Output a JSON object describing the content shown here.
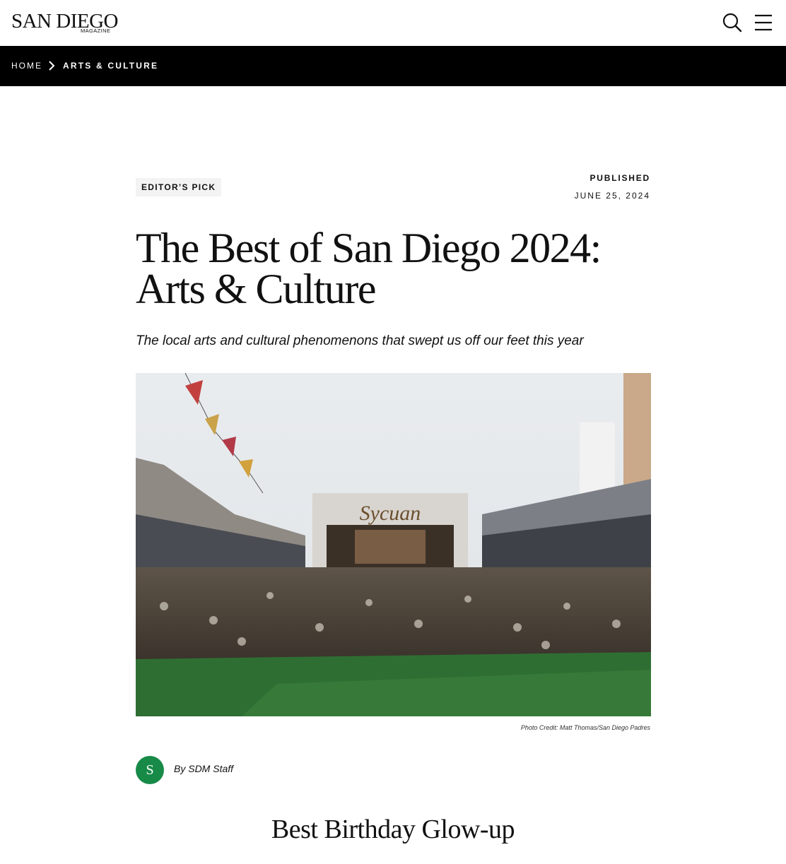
{
  "header": {
    "logo_main": "SAN DIEGO",
    "logo_sub": "MAGAZINE",
    "icons": {
      "search": "search-icon",
      "menu": "hamburger-menu-icon"
    }
  },
  "breadcrumb": {
    "home": "HOME",
    "current": "ARTS & CULTURE",
    "separator_icon": "chevron-right-icon"
  },
  "article": {
    "badge": "EDITOR’S PICK",
    "published_label": "PUBLISHED",
    "published_date": "JUNE 25, 2024",
    "title": "The Best of San Diego 2024: Arts & Culture",
    "dek": "The local arts and cultural phenomenons that swept us off our feet this year",
    "hero_sign": "Sycuan",
    "photo_credit": "Photo Credit: Matt Thomas/San Diego Padres",
    "author_initial": "S",
    "byline_prefix": "By",
    "author": "SDM Staff",
    "section_title": "Best Birthday Glow-up"
  },
  "colors": {
    "breadcrumb_bg": "#000000",
    "avatar_bg": "#178a47",
    "badge_bg": "#f3f3f3"
  }
}
